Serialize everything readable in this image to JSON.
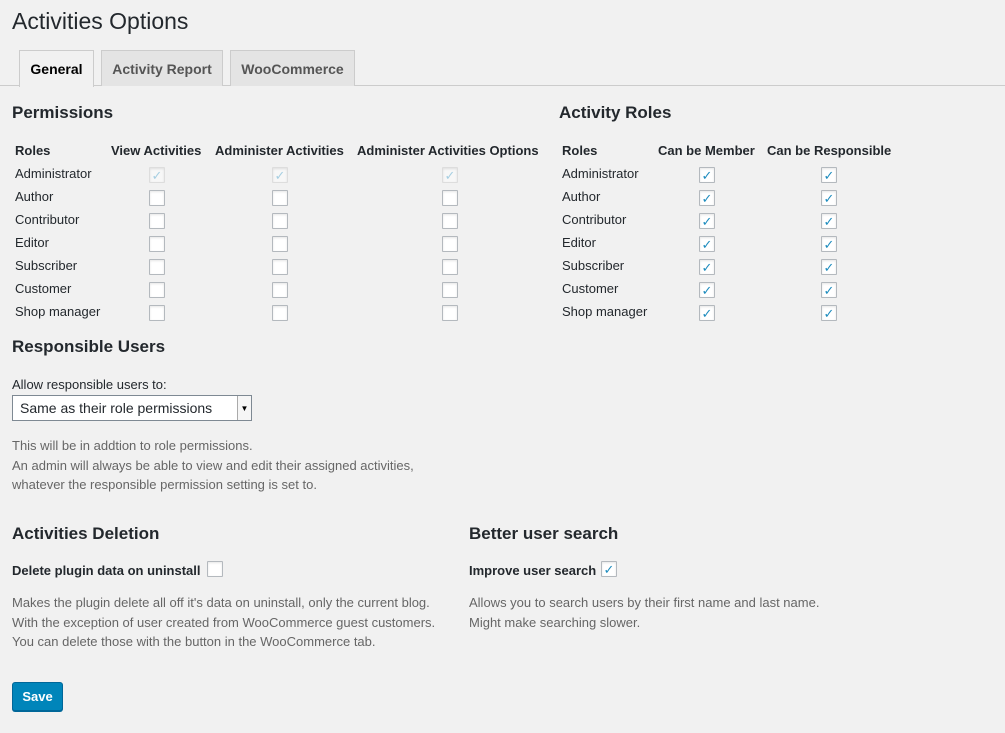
{
  "page_title": "Activities Options",
  "tabs": [
    {
      "label": "General",
      "active": true
    },
    {
      "label": "Activity Report",
      "active": false
    },
    {
      "label": "WooCommerce",
      "active": false
    }
  ],
  "permissions": {
    "heading": "Permissions",
    "columns": [
      "Roles",
      "View Activities",
      "Administer Activities",
      "Administer Activities Options"
    ],
    "rows": [
      {
        "role": "Administrator",
        "values": [
          true,
          true,
          true
        ],
        "disabled": true
      },
      {
        "role": "Author",
        "values": [
          false,
          false,
          false
        ],
        "disabled": false
      },
      {
        "role": "Contributor",
        "values": [
          false,
          false,
          false
        ],
        "disabled": false
      },
      {
        "role": "Editor",
        "values": [
          false,
          false,
          false
        ],
        "disabled": false
      },
      {
        "role": "Subscriber",
        "values": [
          false,
          false,
          false
        ],
        "disabled": false
      },
      {
        "role": "Customer",
        "values": [
          false,
          false,
          false
        ],
        "disabled": false
      },
      {
        "role": "Shop manager",
        "values": [
          false,
          false,
          false
        ],
        "disabled": false
      }
    ]
  },
  "activity_roles": {
    "heading": "Activity Roles",
    "columns": [
      "Roles",
      "Can be Member",
      "Can be Responsible"
    ],
    "rows": [
      {
        "role": "Administrator",
        "values": [
          true,
          true
        ]
      },
      {
        "role": "Author",
        "values": [
          true,
          true
        ]
      },
      {
        "role": "Contributor",
        "values": [
          true,
          true
        ]
      },
      {
        "role": "Editor",
        "values": [
          true,
          true
        ]
      },
      {
        "role": "Subscriber",
        "values": [
          true,
          true
        ]
      },
      {
        "role": "Customer",
        "values": [
          true,
          true
        ]
      },
      {
        "role": "Shop manager",
        "values": [
          true,
          true
        ]
      }
    ]
  },
  "responsible_users": {
    "heading": "Responsible Users",
    "label": "Allow responsible users to:",
    "select_value": "Same as their role permissions",
    "desc_line1": "This will be in addtion to role permissions.",
    "desc_line2": "An admin will always be able to view and edit their assigned activities,",
    "desc_line3": "whatever the responsible permission setting is set to."
  },
  "activities_deletion": {
    "heading": "Activities Deletion",
    "option_label": "Delete plugin data on uninstall",
    "checked": false,
    "desc_line1": "Makes the plugin delete all off it's data on uninstall, only the current blog.",
    "desc_line2": "With the exception of user created from WooCommerce guest customers.",
    "desc_line3": "You can delete those with the button in the WooCommerce tab."
  },
  "better_user_search": {
    "heading": "Better user search",
    "option_label": "Improve user search",
    "checked": true,
    "desc_line1": "Allows you to search users by their first name and last name.",
    "desc_line2": "Might make searching slower."
  },
  "save_label": "Save",
  "icons": {
    "check": "checkmark-icon",
    "dropdown": "chevron-down-icon"
  },
  "colors": {
    "accent": "#0085ba",
    "check": "#1e8cbe",
    "background": "#f1f1f1"
  }
}
